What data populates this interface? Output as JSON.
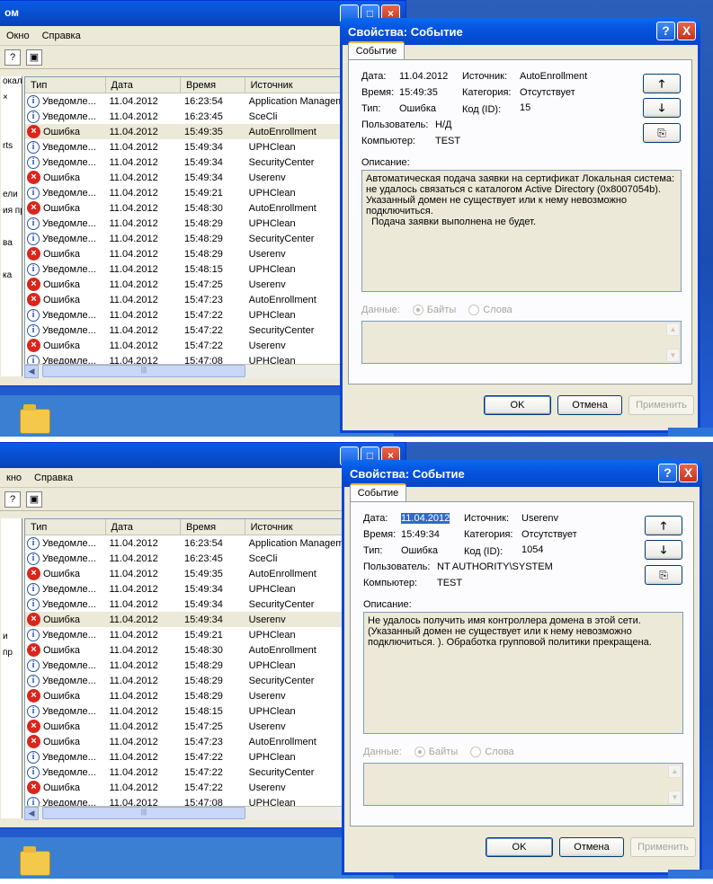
{
  "screens": [
    {
      "bg_window": {
        "title": "ом",
        "menu": [
          "Окно",
          "Справка"
        ],
        "tree_fragments": [
          "окаль",
          "×",
          "",
          "",
          "rts",
          "",
          "",
          "ели",
          "ия пр",
          "",
          "ва",
          "",
          "ка"
        ],
        "columns": [
          "Тип",
          "Дата",
          "Время",
          "Источник"
        ],
        "rows": [
          {
            "icon": "info",
            "type": "Уведомле...",
            "date": "11.04.2012",
            "time": "16:23:54",
            "source": "Application Managem"
          },
          {
            "icon": "info",
            "type": "Уведомле...",
            "date": "11.04.2012",
            "time": "16:23:45",
            "source": "SceCli"
          },
          {
            "icon": "error",
            "type": "Ошибка",
            "date": "11.04.2012",
            "time": "15:49:35",
            "source": "AutoEnrollment",
            "selected": true
          },
          {
            "icon": "info",
            "type": "Уведомле...",
            "date": "11.04.2012",
            "time": "15:49:34",
            "source": "UPHClean"
          },
          {
            "icon": "info",
            "type": "Уведомле...",
            "date": "11.04.2012",
            "time": "15:49:34",
            "source": "SecurityCenter"
          },
          {
            "icon": "error",
            "type": "Ошибка",
            "date": "11.04.2012",
            "time": "15:49:34",
            "source": "Userenv"
          },
          {
            "icon": "info",
            "type": "Уведомле...",
            "date": "11.04.2012",
            "time": "15:49:21",
            "source": "UPHClean"
          },
          {
            "icon": "error",
            "type": "Ошибка",
            "date": "11.04.2012",
            "time": "15:48:30",
            "source": "AutoEnrollment"
          },
          {
            "icon": "info",
            "type": "Уведомле...",
            "date": "11.04.2012",
            "time": "15:48:29",
            "source": "UPHClean"
          },
          {
            "icon": "info",
            "type": "Уведомле...",
            "date": "11.04.2012",
            "time": "15:48:29",
            "source": "SecurityCenter"
          },
          {
            "icon": "error",
            "type": "Ошибка",
            "date": "11.04.2012",
            "time": "15:48:29",
            "source": "Userenv"
          },
          {
            "icon": "info",
            "type": "Уведомле...",
            "date": "11.04.2012",
            "time": "15:48:15",
            "source": "UPHClean"
          },
          {
            "icon": "error",
            "type": "Ошибка",
            "date": "11.04.2012",
            "time": "15:47:25",
            "source": "Userenv"
          },
          {
            "icon": "error",
            "type": "Ошибка",
            "date": "11.04.2012",
            "time": "15:47:23",
            "source": "AutoEnrollment"
          },
          {
            "icon": "info",
            "type": "Уведомле...",
            "date": "11.04.2012",
            "time": "15:47:22",
            "source": "UPHClean"
          },
          {
            "icon": "info",
            "type": "Уведомле...",
            "date": "11.04.2012",
            "time": "15:47:22",
            "source": "SecurityCenter"
          },
          {
            "icon": "error",
            "type": "Ошибка",
            "date": "11.04.2012",
            "time": "15:47:22",
            "source": "Userenv"
          },
          {
            "icon": "info",
            "type": "Уведомле...",
            "date": "11.04.2012",
            "time": "15:47:08",
            "source": "UPHClean"
          }
        ]
      },
      "dialog": {
        "title": "Свойства: Событие",
        "tab": "Событие",
        "labels": {
          "date": "Дата:",
          "time": "Время:",
          "type": "Тип:",
          "user": "Пользователь:",
          "computer": "Компьютер:",
          "source": "Источник:",
          "category": "Категория:",
          "code": "Код (ID):"
        },
        "values": {
          "date": "11.04.2012",
          "time": "15:49:35",
          "type": "Ошибка",
          "user": "Н/Д",
          "computer": "TEST",
          "source": "AutoEnrollment",
          "category": "Отсутствует",
          "code": "15"
        },
        "date_selected": false,
        "description_label": "Описание:",
        "description": "Автоматическая подача заявки на сертификат Локальная система: не удалось связаться с каталогом Active Directory (0x8007054b). Указанный домен не существует или к нему невозможно подключиться.\n  Подача заявки выполнена не будет.",
        "data_label": "Данные:",
        "radio_bytes": "Байты",
        "radio_words": "Слова",
        "ok": "OK",
        "cancel": "Отмена",
        "apply": "Применить",
        "help": "?",
        "close": "X"
      }
    },
    {
      "bg_window": {
        "title": "",
        "menu": [
          "кно",
          "Справка"
        ],
        "tree_fragments": [
          "",
          "",
          "",
          "",
          "",
          "",
          "",
          "и",
          "пр",
          "",
          "",
          "",
          ""
        ],
        "columns": [
          "Тип",
          "Дата",
          "Время",
          "Источник"
        ],
        "rows": [
          {
            "icon": "info",
            "type": "Уведомле...",
            "date": "11.04.2012",
            "time": "16:23:54",
            "source": "Application Management"
          },
          {
            "icon": "info",
            "type": "Уведомле...",
            "date": "11.04.2012",
            "time": "16:23:45",
            "source": "SceCli"
          },
          {
            "icon": "error",
            "type": "Ошибка",
            "date": "11.04.2012",
            "time": "15:49:35",
            "source": "AutoEnrollment"
          },
          {
            "icon": "info",
            "type": "Уведомле...",
            "date": "11.04.2012",
            "time": "15:49:34",
            "source": "UPHClean"
          },
          {
            "icon": "info",
            "type": "Уведомле...",
            "date": "11.04.2012",
            "time": "15:49:34",
            "source": "SecurityCenter"
          },
          {
            "icon": "error",
            "type": "Ошибка",
            "date": "11.04.2012",
            "time": "15:49:34",
            "source": "Userenv",
            "selected": true
          },
          {
            "icon": "info",
            "type": "Уведомле...",
            "date": "11.04.2012",
            "time": "15:49:21",
            "source": "UPHClean"
          },
          {
            "icon": "error",
            "type": "Ошибка",
            "date": "11.04.2012",
            "time": "15:48:30",
            "source": "AutoEnrollment"
          },
          {
            "icon": "info",
            "type": "Уведомле...",
            "date": "11.04.2012",
            "time": "15:48:29",
            "source": "UPHClean"
          },
          {
            "icon": "info",
            "type": "Уведомле...",
            "date": "11.04.2012",
            "time": "15:48:29",
            "source": "SecurityCenter"
          },
          {
            "icon": "error",
            "type": "Ошибка",
            "date": "11.04.2012",
            "time": "15:48:29",
            "source": "Userenv"
          },
          {
            "icon": "info",
            "type": "Уведомле...",
            "date": "11.04.2012",
            "time": "15:48:15",
            "source": "UPHClean"
          },
          {
            "icon": "error",
            "type": "Ошибка",
            "date": "11.04.2012",
            "time": "15:47:25",
            "source": "Userenv"
          },
          {
            "icon": "error",
            "type": "Ошибка",
            "date": "11.04.2012",
            "time": "15:47:23",
            "source": "AutoEnrollment"
          },
          {
            "icon": "info",
            "type": "Уведомле...",
            "date": "11.04.2012",
            "time": "15:47:22",
            "source": "UPHClean"
          },
          {
            "icon": "info",
            "type": "Уведомле...",
            "date": "11.04.2012",
            "time": "15:47:22",
            "source": "SecurityCenter"
          },
          {
            "icon": "error",
            "type": "Ошибка",
            "date": "11.04.2012",
            "time": "15:47:22",
            "source": "Userenv"
          },
          {
            "icon": "info",
            "type": "Уведомле...",
            "date": "11.04.2012",
            "time": "15:47:08",
            "source": "UPHClean"
          }
        ]
      },
      "dialog": {
        "title": "Свойства: Событие",
        "tab": "Событие",
        "labels": {
          "date": "Дата:",
          "time": "Время:",
          "type": "Тип:",
          "user": "Пользователь:",
          "computer": "Компьютер:",
          "source": "Источник:",
          "category": "Категория:",
          "code": "Код (ID):"
        },
        "values": {
          "date": "11.04.2012",
          "time": "15:49:34",
          "type": "Ошибка",
          "user": "NT AUTHORITY\\SYSTEM",
          "computer": "TEST",
          "source": "Userenv",
          "category": "Отсутствует",
          "code": "1054"
        },
        "date_selected": true,
        "description_label": "Описание:",
        "description": "Не удалось получить имя контроллера домена в этой сети. (Указанный домен не существует или к нему невозможно подключиться. ). Обработка групповой политики прекращена.",
        "data_label": "Данные:",
        "radio_bytes": "Байты",
        "radio_words": "Слова",
        "ok": "OK",
        "cancel": "Отмена",
        "apply": "Применить",
        "help": "?",
        "close": "X"
      }
    }
  ]
}
